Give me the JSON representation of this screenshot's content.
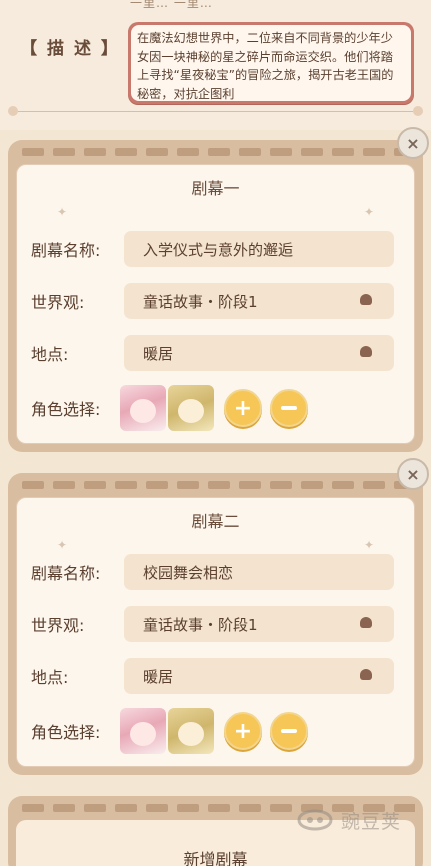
{
  "description": {
    "label": "【 描 述 】",
    "faint_top_text": "一里…  一里…",
    "text": "在魔法幻想世界中，二位来自不同背景的少年少女因一块神秘的星之碎片而命运交织。他们将踏上寻找“星夜秘宝”的冒险之旅，揭开古老王国的秘密，对抗企图利"
  },
  "scenes": [
    {
      "title": "剧幕一",
      "name_label": "剧幕名称:",
      "name_value": "入学仪式与意外的邂逅",
      "world_label": "世界观:",
      "world_value": "童话故事・阶段1",
      "location_label": "地点:",
      "location_value": "暖居",
      "role_label": "角色选择:",
      "close_icon": "×"
    },
    {
      "title": "剧幕二",
      "name_label": "剧幕名称:",
      "name_value": "校园舞会相恋",
      "world_label": "世界观:",
      "world_value": "童话故事・阶段1",
      "location_label": "地点:",
      "location_value": "暖居",
      "role_label": "角色选择:",
      "close_icon": "×"
    }
  ],
  "add_scene_label": "新增剧幕",
  "watermark_text": "豌豆荚",
  "buttons": {
    "plus": "+"
  },
  "colors": {
    "accent_yellow": "#f6c657",
    "desc_border": "#c9786c",
    "card_frame": "#d8bda1"
  },
  "icons": {
    "close": "close-icon",
    "plus": "plus-icon",
    "minus": "minus-icon",
    "caret": "caret-up-icon",
    "star": "star-icon"
  }
}
